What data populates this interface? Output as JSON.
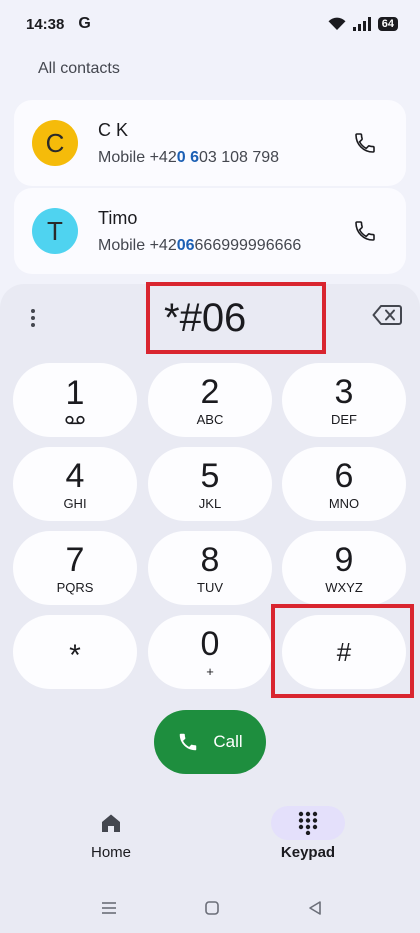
{
  "status_bar": {
    "time": "14:38",
    "carrier_glyph": "G",
    "battery": "64",
    "icons": [
      "wifi-icon",
      "signal-icon",
      "battery-icon"
    ]
  },
  "contacts": {
    "section_label": "All contacts",
    "items": [
      {
        "initial": "C",
        "name": "C K",
        "number_prefix": "Mobile +42",
        "number_highlight_1": "0 6",
        "number_middle": "",
        "number_suffix": "03 108 798",
        "avatar_color": "#f5bb0a"
      },
      {
        "initial": "T",
        "name": "Timo",
        "number_prefix": "Mobile +42",
        "number_highlight_1": "06",
        "number_middle": "",
        "number_suffix": "666999996666",
        "avatar_color": "#4fd3f0"
      }
    ]
  },
  "dialer": {
    "input_value": "*#06",
    "menu_icon": "more-vert-icon",
    "backspace_icon": "backspace-icon",
    "keys": [
      {
        "digit": "1",
        "letters": "",
        "sub_icon": "voicemail-icon"
      },
      {
        "digit": "2",
        "letters": "ABC"
      },
      {
        "digit": "3",
        "letters": "DEF"
      },
      {
        "digit": "4",
        "letters": "GHI"
      },
      {
        "digit": "5",
        "letters": "JKL"
      },
      {
        "digit": "6",
        "letters": "MNO"
      },
      {
        "digit": "7",
        "letters": "PQRS"
      },
      {
        "digit": "8",
        "letters": "TUV"
      },
      {
        "digit": "9",
        "letters": "WXYZ"
      },
      {
        "digit": "*",
        "letters": ""
      },
      {
        "digit": "0",
        "letters": "+"
      },
      {
        "digit": "#",
        "letters": ""
      }
    ],
    "call_label": "Call",
    "call_color": "#1e8e3e"
  },
  "bottom_nav": {
    "home_label": "Home",
    "keypad_label": "Keypad",
    "active": "Keypad"
  },
  "system_nav": [
    "menu-icon",
    "home-square-icon",
    "back-triangle-icon"
  ],
  "highlight_color": "#d9252f"
}
